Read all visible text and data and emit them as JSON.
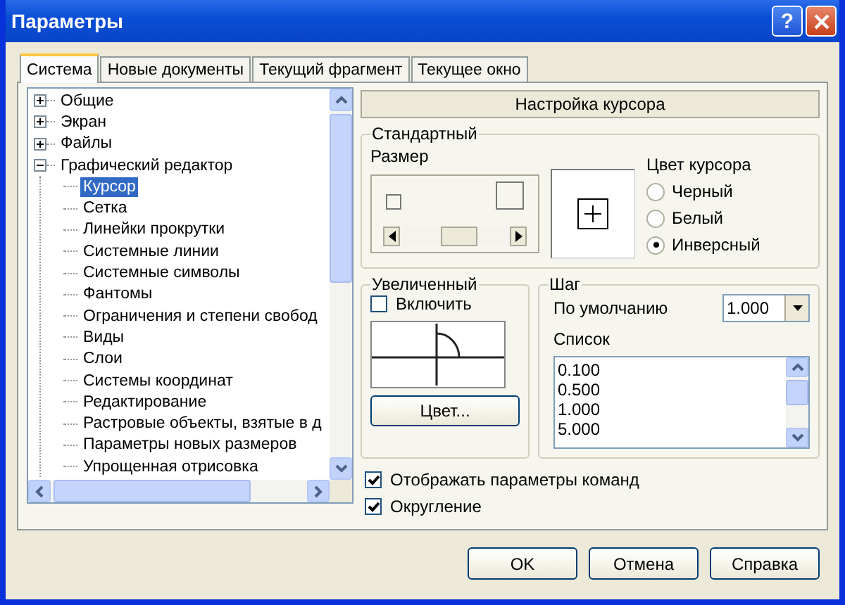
{
  "window": {
    "title": "Параметры",
    "help_button": "?"
  },
  "tabs": [
    {
      "label": "Система",
      "selected": true
    },
    {
      "label": "Новые документы",
      "selected": false
    },
    {
      "label": "Текущий фрагмент",
      "selected": false
    },
    {
      "label": "Текущее окно",
      "selected": false
    }
  ],
  "tree": [
    {
      "label": "Общие",
      "expanded": false,
      "selected": false
    },
    {
      "label": "Экран",
      "expanded": false,
      "selected": false
    },
    {
      "label": "Файлы",
      "expanded": false,
      "selected": false
    },
    {
      "label": "Графический редактор",
      "expanded": true,
      "selected": false,
      "children": [
        {
          "label": "Курсор",
          "selected": true
        },
        {
          "label": "Сетка",
          "selected": false
        },
        {
          "label": "Линейки прокрутки",
          "selected": false
        },
        {
          "label": "Системные линии",
          "selected": false
        },
        {
          "label": "Системные символы",
          "selected": false
        },
        {
          "label": "Фантомы",
          "selected": false
        },
        {
          "label": "Ограничения и степени свобод",
          "selected": false
        },
        {
          "label": "Виды",
          "selected": false
        },
        {
          "label": "Слои",
          "selected": false
        },
        {
          "label": "Системы координат",
          "selected": false
        },
        {
          "label": "Редактирование",
          "selected": false
        },
        {
          "label": "Растровые объекты, взятые в д",
          "selected": false
        },
        {
          "label": "Параметры новых размеров",
          "selected": false
        },
        {
          "label": "Упрощенная отрисовка",
          "selected": false
        }
      ]
    }
  ],
  "panel": {
    "header": "Настройка курсора",
    "standard": {
      "title": "Стандартный",
      "size_label": "Размер",
      "size_slider": {
        "level": 0.55
      },
      "color_label": "Цвет курсора",
      "colors": [
        {
          "label": "Черный",
          "selected": false
        },
        {
          "label": "Белый",
          "selected": false
        },
        {
          "label": "Инверсный",
          "selected": true
        }
      ]
    },
    "enlarged": {
      "title": "Увеличенный",
      "enable": {
        "label": "Включить",
        "checked": false
      },
      "color_button": "Цвет..."
    },
    "step": {
      "title": "Шаг",
      "default_label": "По умолчанию",
      "default_value": "1.000",
      "list_label": "Список",
      "list": [
        "0.100",
        "0.500",
        "1.000",
        "5.000"
      ]
    },
    "options": [
      {
        "label": "Отображать параметры команд",
        "checked": true
      },
      {
        "label": "Округление",
        "checked": true
      }
    ]
  },
  "buttons": [
    "OK",
    "Отмена",
    "Справка"
  ]
}
